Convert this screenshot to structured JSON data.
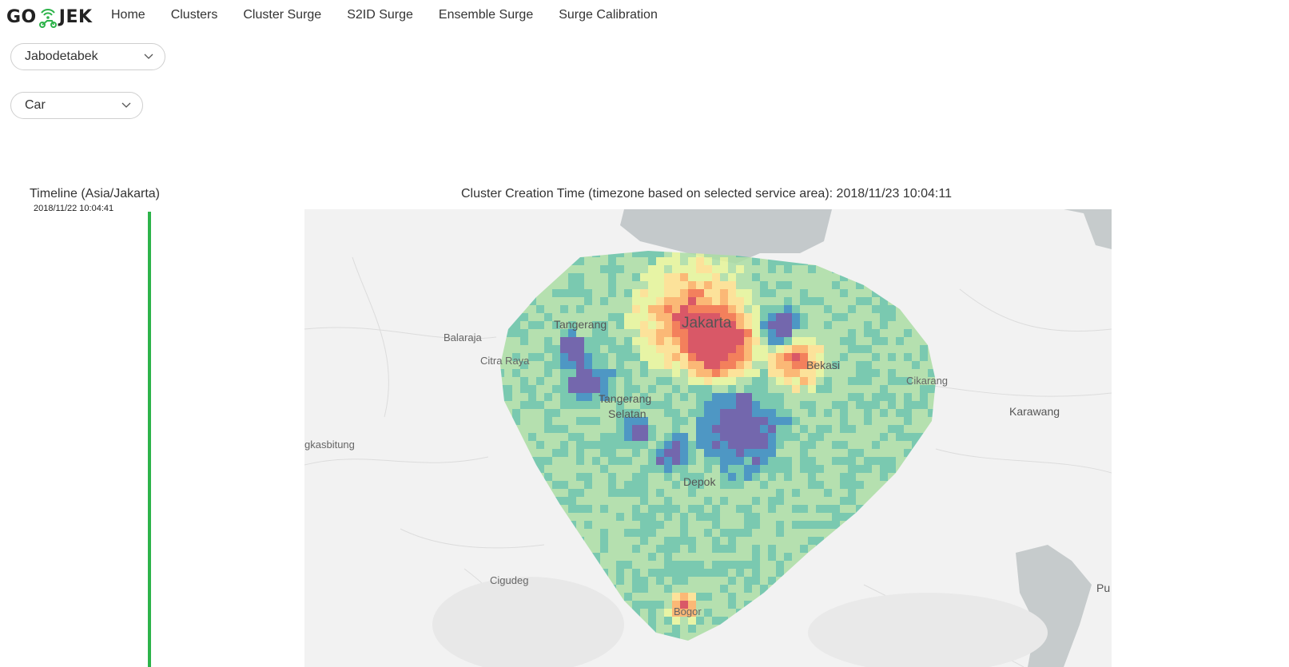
{
  "brand": {
    "name_left": "GO",
    "name_right": "JEK",
    "accent": "#2db34a"
  },
  "nav": {
    "items": [
      {
        "label": "Home"
      },
      {
        "label": "Clusters"
      },
      {
        "label": "Cluster Surge"
      },
      {
        "label": "S2ID Surge"
      },
      {
        "label": "Ensemble Surge"
      },
      {
        "label": "Surge Calibration"
      }
    ]
  },
  "filters": {
    "service_area": {
      "selected": "Jabodetabek"
    },
    "service_type": {
      "selected": "Car"
    }
  },
  "timeline": {
    "title": "Timeline (Asia/Jakarta)",
    "start_time": "2018/11/22 10:04:41"
  },
  "cluster": {
    "caption": "Cluster Creation Time (timezone based on selected service area): 2018/11/23 10:04:11"
  },
  "map": {
    "labels": {
      "jakarta": "Jakarta",
      "tangerang": "Tangerang",
      "balaraja": "Balaraja",
      "citra_raya": "Citra Raya",
      "bekasi": "Bekasi",
      "cikarang": "Cikarang",
      "karawang": "Karawang",
      "tangerang_selatan_1": "Tangerang",
      "tangerang_selatan_2": "Selatan",
      "rangkasbitung": "gkasbitung",
      "depok": "Depok",
      "cigudeg": "Cigudeg",
      "bogor": "Bogor",
      "purwakarta": "Pu"
    },
    "heat_colors": [
      "#5e4fa2",
      "#3288bd",
      "#66c2a5",
      "#abdda4",
      "#e6f598",
      "#fee08b",
      "#fdae61",
      "#f46d43",
      "#d53e4f"
    ]
  }
}
